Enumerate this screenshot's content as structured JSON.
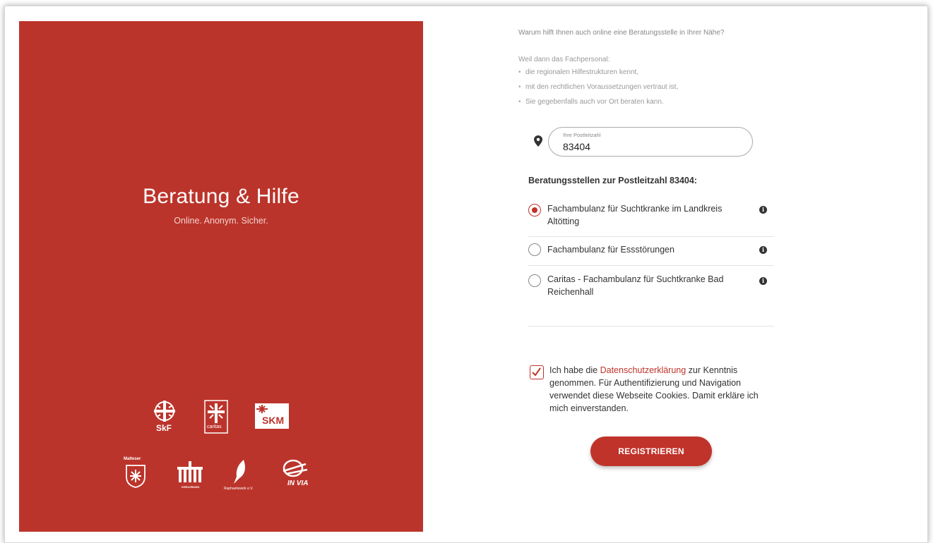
{
  "hero": {
    "title": "Beratung & Hilfe",
    "subtitle": "Online. Anonym. Sicher.",
    "background_color": "#bb342b",
    "logos": {
      "skf": "SkF",
      "caritas": "caritas",
      "skm": "SKM",
      "malteser": "Malteser",
      "kreuzbund": "KREUZBUND",
      "raphaelswerk": "Raphaelswerk e.V.",
      "invia": "IN VIA"
    }
  },
  "intro": {
    "question": "Warum hilft Ihnen auch online eine Beratungsstelle in Ihrer Nähe?",
    "lead": "Weil dann das Fachpersonal:",
    "bullets": [
      "die regionalen Hilfestrukturen kennt,",
      "mit den rechtlichen Voraussetzungen vertraut ist,",
      "Sie gegebenfalls auch vor Ort beraten kann."
    ]
  },
  "postcode": {
    "label": "Ihre Postleitzahl",
    "value": "83404",
    "icon": "map-pin-icon"
  },
  "agencies": {
    "title": "Beratungsstellen zur Postleitzahl 83404:",
    "items": [
      {
        "label": "Fachambulanz für Suchtkranke im Landkreis Altötting",
        "selected": true
      },
      {
        "label": "Fachambulanz für Essstörungen",
        "selected": false
      },
      {
        "label": "Caritas - Fachambulanz für Suchtkranke Bad Reichenhall",
        "selected": false
      }
    ],
    "info_icon": "info-icon"
  },
  "consent": {
    "checked": true,
    "text_before": "Ich habe die ",
    "link": "Datenschutzerklärung",
    "text_after": " zur Kenntnis genommen. Für Authentifizierung und Navigation verwendet diese Webseite Cookies. Damit erkläre ich mich einverstanden."
  },
  "register_button": "REGISTRIEREN",
  "colors": {
    "accent": "#c0332a"
  }
}
